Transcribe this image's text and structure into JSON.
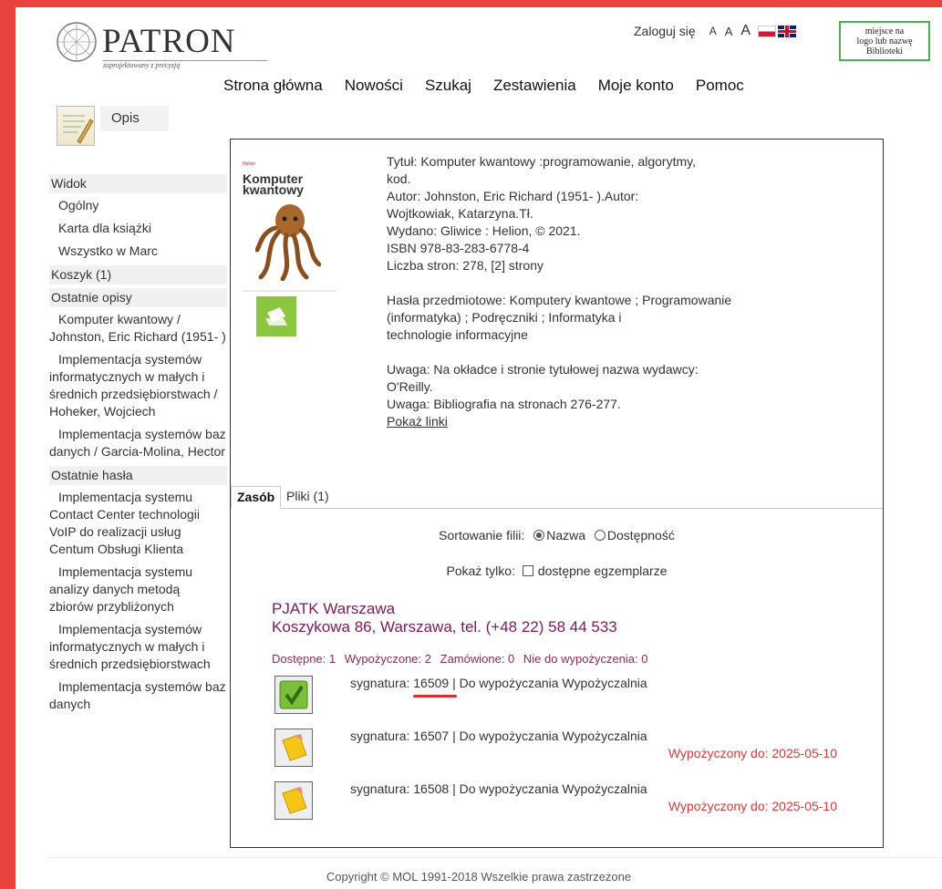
{
  "header": {
    "logo_text": "PATRON",
    "logo_tagline": "zaprojektowany z precyzją",
    "login": "Zaloguj się",
    "font_sizes": [
      "A",
      "A",
      "A"
    ],
    "library_box": [
      "miejsce na",
      "logo lub nazwę",
      "Biblioteki"
    ]
  },
  "nav": [
    "Strona główna",
    "Nowości",
    "Szukaj",
    "Zestawienia",
    "Moje konto",
    "Pomoc"
  ],
  "sidebar": {
    "opis_label": "Opis",
    "widok_head": "Widok",
    "widok_items": [
      "Ogólny",
      "Karta dla książki",
      "Wszystko w Marc"
    ],
    "koszyk": "Koszyk (1)",
    "recent_desc_head": "Ostatnie opisy",
    "recent_desc": [
      "Komputer kwantowy / Johnston, Eric Richard (1951- )",
      "Implementacja systemów informatycznych w małych i średnich przedsiębiorstwach / Hoheker, Wojciech",
      "Implementacja systemów baz danych / Garcia-Molina, Hector"
    ],
    "recent_terms_head": "Ostatnie hasła",
    "recent_terms": [
      "Implementacja systemu Contact Center technologii VoIP do realizacji usług Centum Obsługi Klienta",
      "Implementacja systemu analizy danych metodą zbiorów przybliżonych",
      "Implementacja systemów informatycznych w małych i średnich przedsiębiorstwach",
      "Implementacja systemów baz danych"
    ]
  },
  "cover": {
    "tag": "Helion",
    "title": "Komputer kwantowy"
  },
  "record": {
    "title_line1": "Tytuł: Komputer kwantowy :programowanie, algorytmy,",
    "title_line2": "kod.",
    "author_line1": "Autor: Johnston, Eric Richard (1951- ).Autor:",
    "author_line2": "Wojtkowiak, Katarzyna.Tł.",
    "published": "Wydano: Gliwice : Helion, © 2021.",
    "isbn": "ISBN 978-83-283-6778-4",
    "pages": "Liczba stron: 278, [2] strony",
    "subjects_line1": "Hasła przedmiotowe: Komputery kwantowe ; Programowanie",
    "subjects_line2": "(informatyka) ; Podręczniki ; Informatyka i",
    "subjects_line3": "technologie informacyjne",
    "note1_line1": "Uwaga: Na okładce i stronie tytułowej nazwa wydawcy:",
    "note1_line2": "O'Reilly.",
    "note2": "Uwaga: Bibliografia na stronach 276-277.",
    "links": "Pokaż linki"
  },
  "tabs": [
    "Zasób",
    "Pliki (1)"
  ],
  "sorting": {
    "label": "Sortowanie filii:",
    "opt1": "Nazwa",
    "opt2": "Dostępność"
  },
  "filter": {
    "label": "Pokaż tylko:",
    "opt": "dostępne egzemplarze"
  },
  "branch": {
    "name": "PJATK Warszawa",
    "address": "Koszykowa 86, Warszawa, tel. (+48 22) 58 44 533",
    "available": "Dostępne: 1",
    "lent": "Wypożyczone: 2",
    "ordered": "Zamówione: 0",
    "not_lendable": "Nie do wypożyczenia: 0"
  },
  "copies": [
    {
      "sig": "sygnatura: 16509 | Do wypożyczania Wypożyczalnia",
      "due": "",
      "status": "available"
    },
    {
      "sig": "sygnatura: 16507 | Do wypożyczania Wypożyczalnia",
      "due": "Wypożyczony do: 2025-05-10",
      "status": "lent"
    },
    {
      "sig": "sygnatura: 16508 | Do wypożyczania Wypożyczalnia",
      "due": "Wypożyczony do: 2025-05-10",
      "status": "lent"
    }
  ],
  "footer": "Copyright © MOL 1991-2018 Wszelkie prawa zastrzeżone",
  "colors": {
    "frame": "#e8443d",
    "branch": "#7b1a5c",
    "due": "#d63b3b",
    "print_icon": "#8cc63f"
  }
}
